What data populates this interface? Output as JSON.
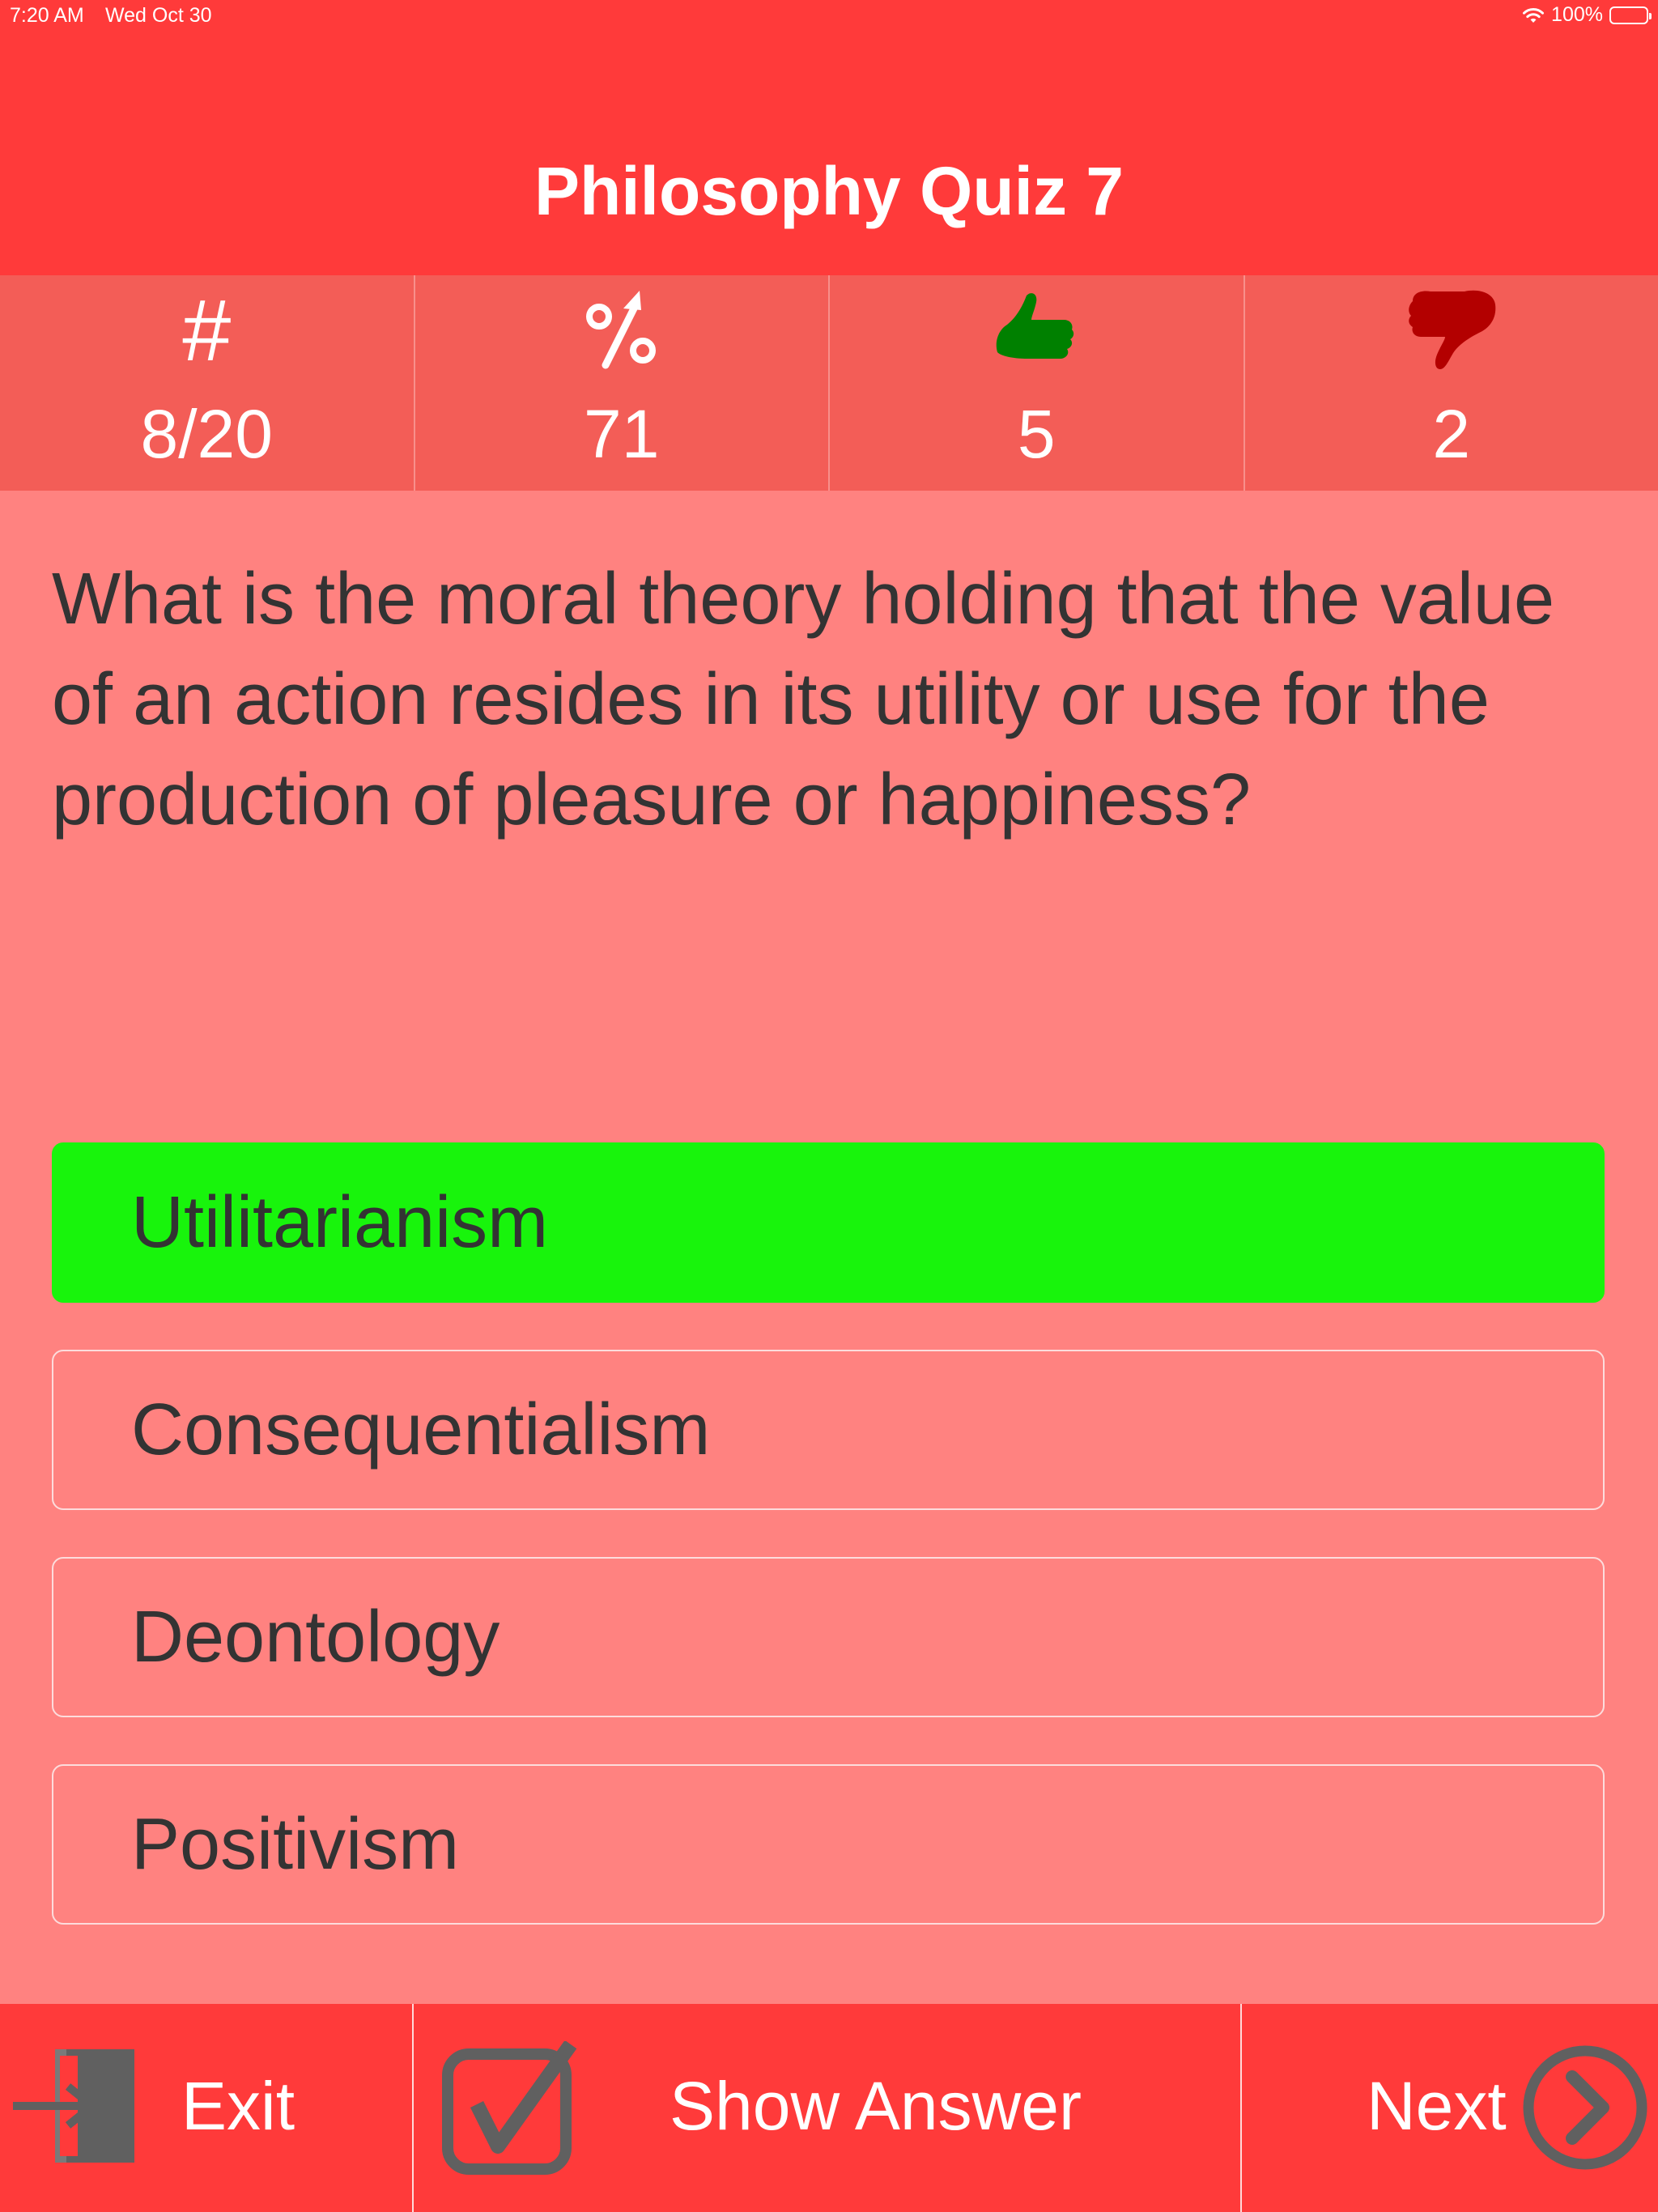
{
  "status_bar": {
    "time": "7:20 AM",
    "date": "Wed Oct 30",
    "battery": "100%"
  },
  "header": {
    "title": "Philosophy Quiz 7"
  },
  "stats": {
    "question_symbol": "#",
    "question_progress": "8/20",
    "percent_value": "71",
    "correct_count": "5",
    "wrong_count": "2",
    "icons": [
      "hash-icon",
      "percent-up-icon",
      "thumbs-up-icon",
      "thumbs-down-icon"
    ],
    "colors": {
      "thumbs_up": "#008000",
      "thumbs_down": "#b30000"
    }
  },
  "question": {
    "text": "What is the moral theory holding that the value of an action resides in its utility or use for the production of pleasure or happiness?"
  },
  "answers": [
    {
      "label": "Utilitarianism",
      "state": "correct"
    },
    {
      "label": "Consequentialism",
      "state": "none"
    },
    {
      "label": "Deontology",
      "state": "none"
    },
    {
      "label": "Positivism",
      "state": "none"
    }
  ],
  "toolbar": {
    "exit_label": "Exit",
    "show_answer_label": "Show Answer",
    "next_label": "Next"
  },
  "colors": {
    "header_bg": "#ff3a3a",
    "stats_bg": "#f35d57",
    "body_bg": "#ff8280",
    "correct_answer": "#18f40c",
    "text_dark": "#333333",
    "toolbar_icon": "#606060"
  }
}
